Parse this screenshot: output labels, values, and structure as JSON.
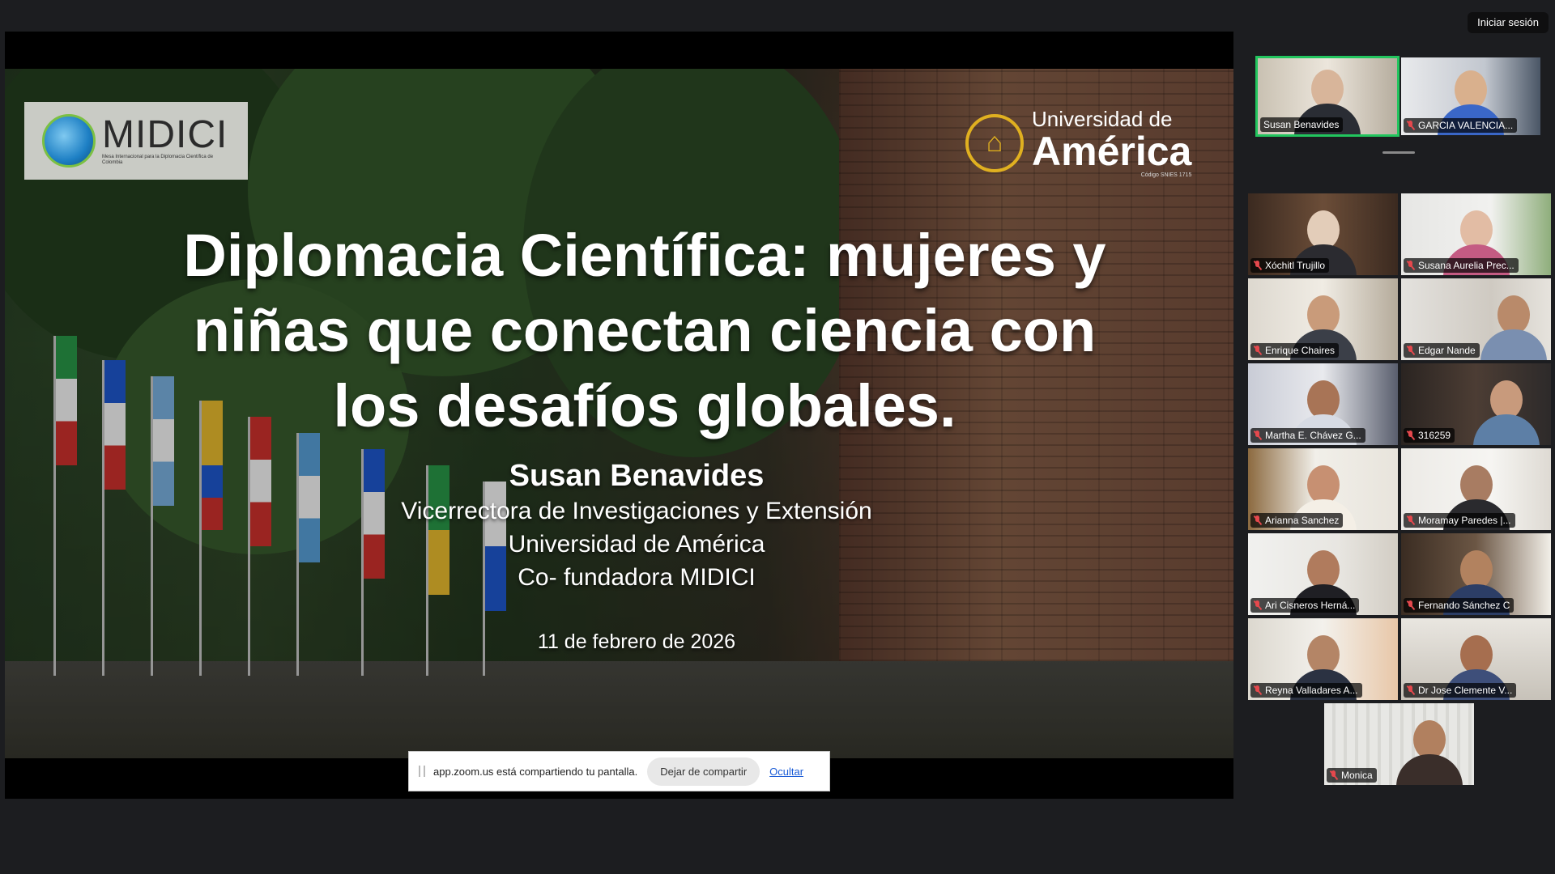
{
  "header": {
    "login_label": "Iniciar sesión"
  },
  "slide": {
    "midici_logo": {
      "name": "MIDICI",
      "subtitle": "Mesa Internacional para la Diplomacia Científica de Colombia"
    },
    "ua_logo": {
      "line1": "Universidad de",
      "line2": "América",
      "code": "Código SNIES 1715"
    },
    "title_lines": [
      "Diplomacia Científica: mujeres y",
      "niñas que conectan ciencia con",
      "los desafíos globales."
    ],
    "speaker_name": "Susan Benavides",
    "speaker_lines": [
      "Vicerrectora de Investigaciones y Extensión",
      "Universidad de América",
      "Co- fundadora MIDICI"
    ],
    "date": "11 de febrero de 2026"
  },
  "share_bar": {
    "message": "app.zoom.us está compartiendo tu pantalla.",
    "stop_label": "Dejar de compartir",
    "hide_label": "Ocultar"
  },
  "participants_top": [
    {
      "name": "Susan Benavides",
      "active": true,
      "muted": false
    },
    {
      "name": "GARCIA VALENCIA...",
      "active": false,
      "muted": true
    }
  ],
  "participants_grid": [
    {
      "name": "Xóchitl Trujillo",
      "muted": true
    },
    {
      "name": "Susana Aurelia Prec...",
      "muted": true
    },
    {
      "name": "Enrique Chaires",
      "muted": true
    },
    {
      "name": "Edgar Nande",
      "muted": true
    },
    {
      "name": "Martha E. Chávez G...",
      "muted": true
    },
    {
      "name": "316259",
      "muted": true
    },
    {
      "name": "Arianna Sanchez",
      "muted": true
    },
    {
      "name": "Moramay Paredes |...",
      "muted": true
    },
    {
      "name": "Ari Cisneros Herná...",
      "muted": true
    },
    {
      "name": "Fernando Sánchez C",
      "muted": true
    },
    {
      "name": "Reyna Valladares A...",
      "muted": true
    },
    {
      "name": "Dr Jose Clemente V...",
      "muted": true
    },
    {
      "name": "Monica",
      "muted": true
    }
  ]
}
